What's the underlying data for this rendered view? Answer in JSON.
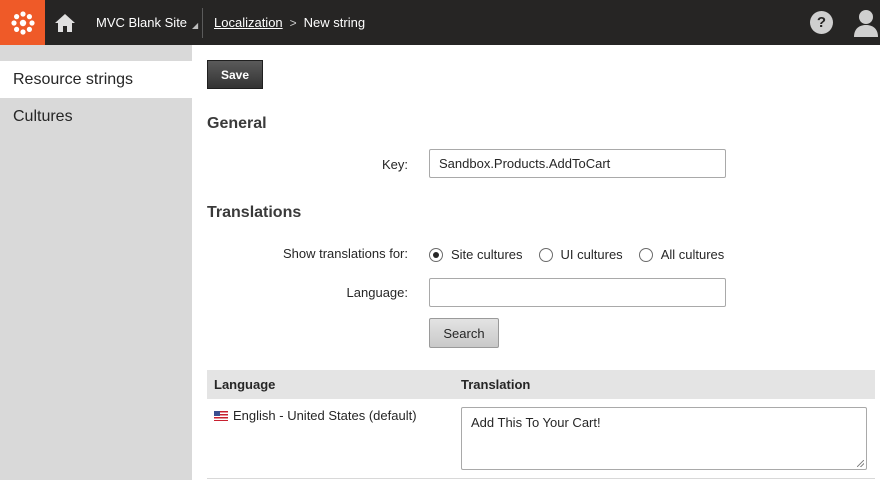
{
  "header": {
    "logo_icon": "kentico-gear-icon",
    "home_icon": "home-icon",
    "site_name": "MVC Blank Site",
    "breadcrumb": {
      "parent": "Localization",
      "current": "New string"
    },
    "help_icon": "help-icon",
    "user_icon": "user-icon",
    "accent_color": "#ef5a28"
  },
  "sidebar": {
    "items": [
      {
        "label": "Resource strings",
        "active": true
      },
      {
        "label": "Cultures",
        "active": false
      }
    ]
  },
  "main": {
    "save_label": "Save",
    "general": {
      "title": "General",
      "key_label": "Key:",
      "key_value": "Sandbox.Products.AddToCart"
    },
    "translations": {
      "title": "Translations",
      "show_label": "Show translations for:",
      "options": [
        {
          "label": "Site cultures",
          "selected": true
        },
        {
          "label": "UI cultures",
          "selected": false
        },
        {
          "label": "All cultures",
          "selected": false
        }
      ],
      "language_label": "Language:",
      "language_value": "",
      "search_label": "Search",
      "grid": {
        "columns": [
          "Language",
          "Translation"
        ],
        "rows": [
          {
            "flag_icon": "us-flag-icon",
            "language": "English - United States (default)",
            "translation": "Add This To Your Cart!"
          }
        ]
      }
    }
  }
}
